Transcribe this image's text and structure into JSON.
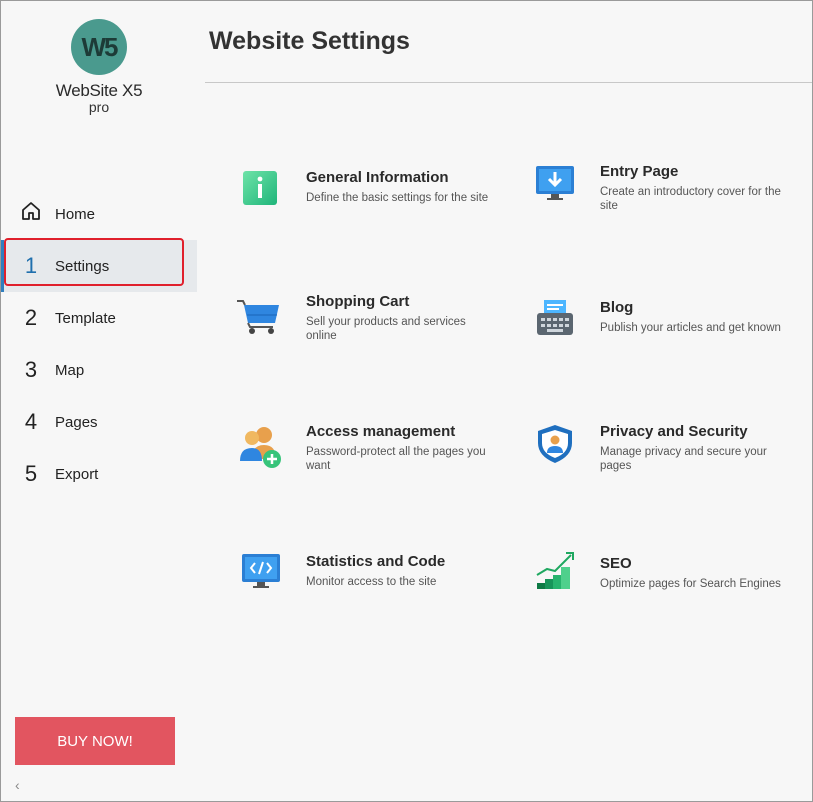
{
  "logo": {
    "mark": "W5",
    "name": "WebSite X5",
    "edition": "pro"
  },
  "sidebar": {
    "items": [
      {
        "num": "",
        "label": "Home",
        "icon": "home-icon"
      },
      {
        "num": "1",
        "label": "Settings"
      },
      {
        "num": "2",
        "label": "Template"
      },
      {
        "num": "3",
        "label": "Map"
      },
      {
        "num": "4",
        "label": "Pages"
      },
      {
        "num": "5",
        "label": "Export"
      }
    ],
    "buy_label": "BUY NOW!",
    "collapse_glyph": "‹"
  },
  "main": {
    "title": "Website Settings",
    "cards": [
      {
        "title": "General Information",
        "desc": "Define the basic settings for the site",
        "icon": "info-icon"
      },
      {
        "title": "Entry Page",
        "desc": "Create an introductory cover for the site",
        "icon": "entry-page-icon"
      },
      {
        "title": "Shopping Cart",
        "desc": "Sell your products and services online",
        "icon": "shopping-cart-icon"
      },
      {
        "title": "Blog",
        "desc": "Publish your articles and get known",
        "icon": "blog-icon"
      },
      {
        "title": "Access management",
        "desc": "Password-protect all the pages you want",
        "icon": "access-users-icon"
      },
      {
        "title": "Privacy and Security",
        "desc": "Manage privacy and secure your pages",
        "icon": "shield-icon"
      },
      {
        "title": "Statistics and Code",
        "desc": "Monitor access to the site",
        "icon": "code-monitor-icon"
      },
      {
        "title": "SEO",
        "desc": "Optimize pages for Search Engines",
        "icon": "seo-chart-icon"
      }
    ]
  },
  "colors": {
    "accent": "#2f7fbf",
    "buy": "#e25560",
    "highlight": "#e0202c",
    "logo": "#4a9a8e"
  }
}
